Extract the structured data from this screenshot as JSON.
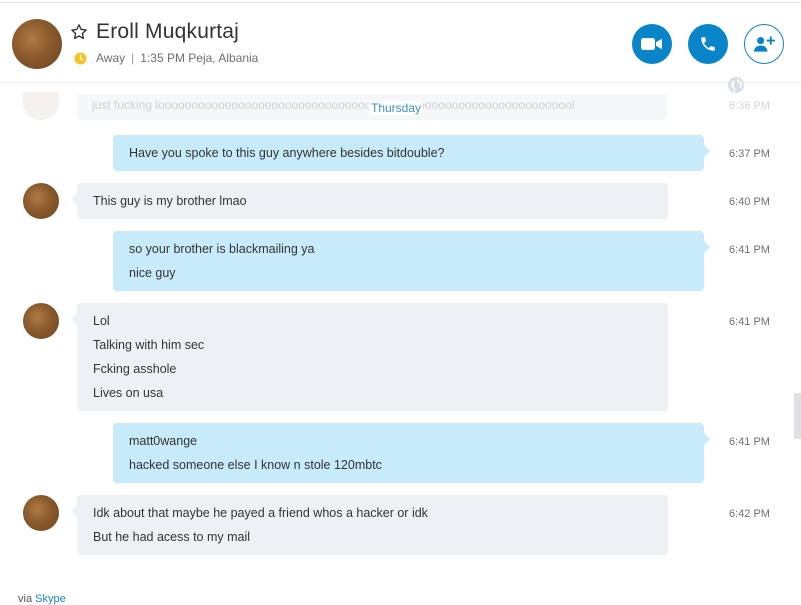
{
  "header": {
    "name": "Eroll Muqkurtaj",
    "status": "Away",
    "local_time": "1:35 PM Peja, Albania",
    "icons": {
      "star": "star-outline-icon",
      "status": "clock-icon",
      "video": "video-camera-icon",
      "call": "phone-icon",
      "add": "add-person-icon",
      "globe": "globe-icon"
    },
    "accent_color": "#0a84c9"
  },
  "chat": {
    "partial_top": {
      "text": "just fucking looooooooooooooooooooooooooooooooooooooooooooooooooooooooooooool",
      "time": "6:36 PM"
    },
    "day_separator": "Thursday",
    "messages": [
      {
        "direction": "out",
        "lines": [
          "Have you spoke to this guy anywhere besides bitdouble?"
        ],
        "time": "6:37 PM"
      },
      {
        "direction": "in",
        "lines": [
          "This guy is my brother lmao"
        ],
        "time": "6:40 PM"
      },
      {
        "direction": "out",
        "lines": [
          "so your brother is blackmailing ya",
          "nice guy"
        ],
        "time": "6:41 PM"
      },
      {
        "direction": "in",
        "lines": [
          "Lol",
          "Talking with him sec",
          "Fcking  asshole",
          "Lives on usa"
        ],
        "time": "6:41 PM"
      },
      {
        "direction": "out",
        "lines": [
          "matt0wange",
          "hacked someone else I know n stole 120mbtc"
        ],
        "time": "6:41 PM"
      },
      {
        "direction": "in",
        "lines": [
          "Idk about that maybe he payed a friend whos a hacker or idk",
          "But he had acess to my mail"
        ],
        "time": "6:42 PM"
      }
    ],
    "colors": {
      "outgoing_bubble": "#c7ebfb",
      "incoming_bubble": "#edf1f6"
    }
  },
  "footer": {
    "prefix": "via",
    "link": "Skype"
  }
}
